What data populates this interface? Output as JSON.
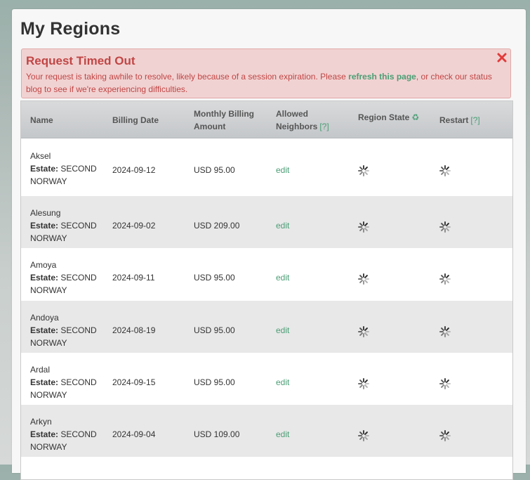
{
  "page": {
    "title": "My Regions"
  },
  "alert": {
    "title": "Request Timed Out",
    "text_before": "Your request is taking awhile to resolve, likely because of a session expiration. Please ",
    "link": "refresh this page",
    "text_after": ", or check our status blog to see if we're experiencing difficulties.",
    "close_icon": "close-x-icon",
    "color": "#c04645",
    "link_color": "#4a9e75"
  },
  "table": {
    "headers": {
      "name": "Name",
      "billing_date": "Billing Date",
      "monthly_line1": "Monthly Billing",
      "monthly_line2": "Amount",
      "neighbors_line1": "Allowed",
      "neighbors_line2": "Neighbors",
      "help": "[?]",
      "region_state": "Region State",
      "restart": "Restart",
      "recycle_icon": "♻"
    },
    "estate_label": "Estate:",
    "rows": [
      {
        "name": "Aksel",
        "estate": "SECOND",
        "estate2": "NORWAY",
        "date": "2024-09-12",
        "amount": "USD 95.00",
        "action": "edit"
      },
      {
        "name": "Alesung",
        "estate": "SECOND",
        "estate2": "NORWAY",
        "date": "2024-09-02",
        "amount": "USD 209.00",
        "action": "edit"
      },
      {
        "name": "Amoya",
        "estate": "SECOND",
        "estate2": "NORWAY",
        "date": "2024-09-11",
        "amount": "USD 95.00",
        "action": "edit"
      },
      {
        "name": "Andoya",
        "estate": "SECOND",
        "estate2": "NORWAY",
        "date": "2024-08-19",
        "amount": "USD 95.00",
        "action": "edit"
      },
      {
        "name": "Ardal",
        "estate": "SECOND",
        "estate2": "NORWAY",
        "date": "2024-09-15",
        "amount": "USD 95.00",
        "action": "edit"
      },
      {
        "name": "Arkyn",
        "estate": "SECOND",
        "estate2": "NORWAY",
        "date": "2024-09-04",
        "amount": "USD 109.00",
        "action": "edit"
      }
    ]
  }
}
